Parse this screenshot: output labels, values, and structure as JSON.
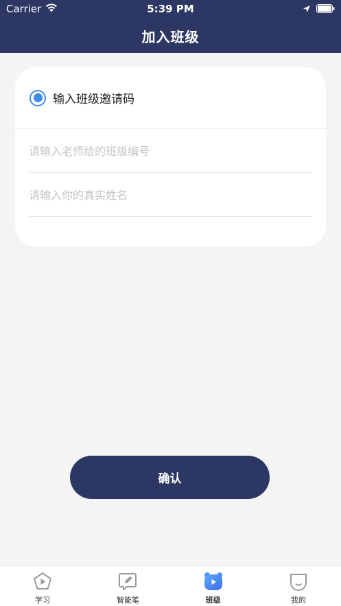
{
  "status_bar": {
    "carrier": "Carrier",
    "time": "5:39 PM"
  },
  "header": {
    "title": "加入班级"
  },
  "card": {
    "radio_label": "输入班级邀请码",
    "class_code_placeholder": "请输入老师给的班级编号",
    "name_placeholder": "请输入你的真实姓名"
  },
  "confirm_label": "确认",
  "tabbar": {
    "items": [
      {
        "label": "学习",
        "icon": "play-pentagon-icon"
      },
      {
        "label": "智能笔",
        "icon": "pen-icon"
      },
      {
        "label": "班级",
        "icon": "class-bear-icon"
      },
      {
        "label": "我的",
        "icon": "profile-face-icon"
      }
    ],
    "active_index": 2
  },
  "colors": {
    "header": "#2c3863",
    "accent": "#3c8ce8",
    "background": "#f4f4f4"
  }
}
